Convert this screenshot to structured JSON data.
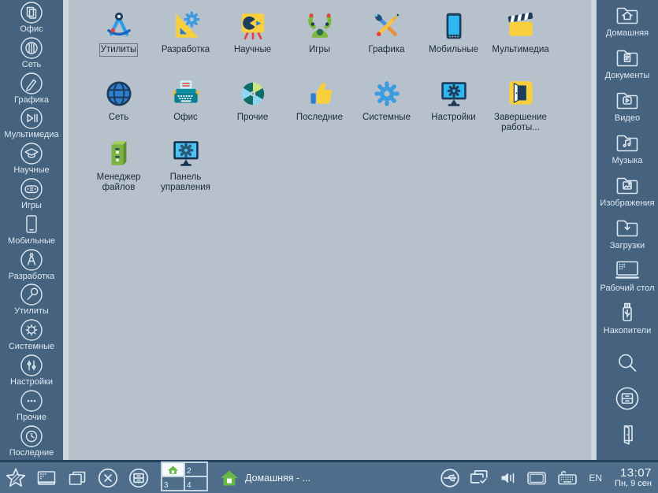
{
  "left_sidebar": {
    "items": [
      {
        "label": "Офис"
      },
      {
        "label": "Сеть"
      },
      {
        "label": "Графика"
      },
      {
        "label": "Мультимедиа"
      },
      {
        "label": "Научные"
      },
      {
        "label": "Игры"
      },
      {
        "label": "Мобильные"
      },
      {
        "label": "Разработка"
      },
      {
        "label": "Утилиты"
      },
      {
        "label": "Системные"
      },
      {
        "label": "Настройки"
      },
      {
        "label": "Прочие"
      },
      {
        "label": "Последние"
      }
    ]
  },
  "main": {
    "apps": [
      {
        "label": "Утилиты",
        "focused": true
      },
      {
        "label": "Разработка"
      },
      {
        "label": "Научные"
      },
      {
        "label": "Игры"
      },
      {
        "label": "Графика"
      },
      {
        "label": "Мобильные"
      },
      {
        "label": "Мультимедиа"
      },
      {
        "label": "Сеть"
      },
      {
        "label": "Офис"
      },
      {
        "label": "Прочие"
      },
      {
        "label": "Последние"
      },
      {
        "label": "Системные"
      },
      {
        "label": "Настройки"
      },
      {
        "label": "Завершение работы..."
      },
      {
        "label": "Менеджер файлов"
      },
      {
        "label": "Панель управления"
      }
    ]
  },
  "right_sidebar": {
    "folders": [
      {
        "label": "Домашняя"
      },
      {
        "label": "Документы"
      },
      {
        "label": "Видео"
      },
      {
        "label": "Музыка"
      },
      {
        "label": "Изображения"
      },
      {
        "label": "Загрузки"
      },
      {
        "label": "Рабочий стол"
      },
      {
        "label": "Накопители"
      }
    ]
  },
  "taskbar": {
    "window_button_label": "Домашняя - ...",
    "pager_cells": [
      "",
      "2",
      "3",
      "4"
    ],
    "language": "EN",
    "clock": {
      "time": "13:07",
      "date": "Пн, 9 сен"
    }
  },
  "colors": {
    "sidebar_bg": "#45627f",
    "main_bg": "#b7c1cb",
    "taskbar_bg": "#4e6d8b",
    "accent_green": "#67b845",
    "icon_stroke": "#dde8f1",
    "yellow": "#f8cf3c",
    "blue": "#2d7fd0",
    "navy": "#1c3d5c"
  }
}
